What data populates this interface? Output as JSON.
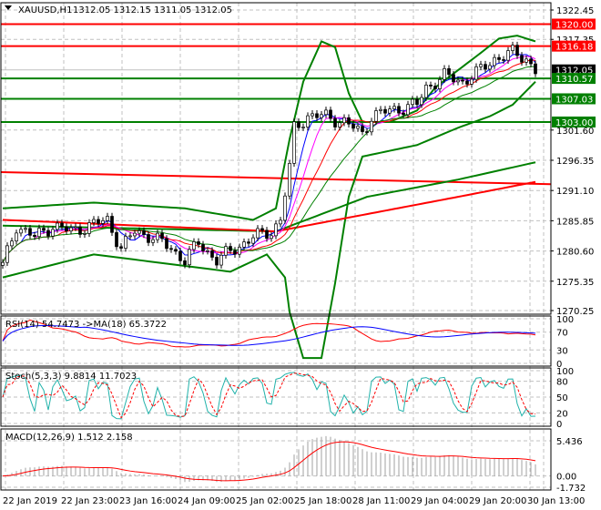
{
  "header": {
    "symbol": "XAUUSD,H1",
    "ohlc": "1312.05 1312.15 1311.05 1312.05"
  },
  "colors": {
    "up": "#008000",
    "down": "#000000",
    "bands": "#008000",
    "red": "#ff0000",
    "green_label": "#008000",
    "red_label": "#ff0000",
    "stoch_main": "#20b2aa",
    "rsi_ma": "#0000ff"
  },
  "chart_data": [
    {
      "type": "candlestick",
      "title": "XAUUSD,H1",
      "ylim": [
        1270.25,
        1322.45
      ],
      "yticks": [
        "1322.45",
        "1317.35",
        "1301.60",
        "1296.35",
        "1291.10",
        "1285.85",
        "1280.60",
        "1275.35",
        "1270.25"
      ],
      "xticks": [
        "22 Jan 2019",
        "22 Jan 23:00",
        "23 Jan 16:00",
        "24 Jan 09:00",
        "25 Jan 02:00",
        "25 Jan 18:00",
        "28 Jan 11:00",
        "29 Jan 04:00",
        "29 Jan 20:00",
        "30 Jan 13:00"
      ],
      "price_anchors": [
        [
          0,
          1278
        ],
        [
          3,
          1285
        ],
        [
          7,
          1283
        ],
        [
          11,
          1285
        ],
        [
          15,
          1284
        ],
        [
          19,
          1285
        ],
        [
          23,
          1286
        ],
        [
          26,
          1281
        ],
        [
          29,
          1284
        ],
        [
          33,
          1283
        ],
        [
          37,
          1281
        ],
        [
          40,
          1279
        ],
        [
          43,
          1282
        ],
        [
          47,
          1279
        ],
        [
          51,
          1281
        ],
        [
          55,
          1283
        ],
        [
          59,
          1284
        ],
        [
          61,
          1286
        ],
        [
          63,
          1295
        ],
        [
          64,
          1302
        ],
        [
          67,
          1304
        ],
        [
          71,
          1304
        ],
        [
          75,
          1303
        ],
        [
          79,
          1301
        ],
        [
          81,
          1304
        ],
        [
          85,
          1305
        ],
        [
          91,
          1306
        ],
        [
          93,
          1309
        ],
        [
          97,
          1311
        ],
        [
          101,
          1310
        ],
        [
          105,
          1312
        ],
        [
          108,
          1314
        ],
        [
          112,
          1315
        ],
        [
          115,
          1314
        ],
        [
          117,
          1312.05
        ]
      ],
      "bb_upper": [
        [
          0,
          1288
        ],
        [
          20,
          1289
        ],
        [
          40,
          1288
        ],
        [
          55,
          1286
        ],
        [
          60,
          1288
        ],
        [
          63,
          1300
        ],
        [
          66,
          1310
        ],
        [
          70,
          1317
        ],
        [
          73,
          1316
        ],
        [
          76,
          1308
        ],
        [
          79,
          1303
        ],
        [
          85,
          1303
        ],
        [
          91,
          1305
        ],
        [
          95,
          1309
        ],
        [
          100,
          1312
        ],
        [
          105,
          1315
        ],
        [
          109,
          1317.5
        ],
        [
          113,
          1318
        ],
        [
          117,
          1317
        ]
      ],
      "bb_lower": [
        [
          0,
          1276
        ],
        [
          5,
          1277
        ],
        [
          20,
          1280
        ],
        [
          40,
          1278
        ],
        [
          50,
          1277
        ],
        [
          58,
          1280
        ],
        [
          62,
          1276
        ],
        [
          63,
          1270
        ],
        [
          66,
          1262
        ],
        [
          70,
          1262
        ],
        [
          73,
          1275
        ],
        [
          76,
          1290
        ],
        [
          79,
          1297
        ],
        [
          85,
          1298
        ],
        [
          91,
          1299
        ],
        [
          100,
          1302
        ],
        [
          107,
          1304
        ],
        [
          112,
          1306
        ],
        [
          117,
          1310
        ]
      ],
      "ma_long_green": [
        [
          0,
          1285
        ],
        [
          60,
          1284
        ],
        [
          80,
          1290
        ],
        [
          100,
          1293
        ],
        [
          117,
          1296
        ]
      ],
      "ma_long_red": [
        [
          0,
          1286
        ],
        [
          60,
          1284
        ],
        [
          80,
          1287
        ],
        [
          100,
          1290
        ],
        [
          117,
          1292.6
        ]
      ],
      "trendline_red": [
        [
          0,
          1294.3
        ],
        [
          121,
          1292.2
        ]
      ],
      "levels": [
        {
          "price": 1320.0,
          "label": "1320.00",
          "color": "#ff0000"
        },
        {
          "price": 1316.18,
          "label": "1316.18",
          "color": "#ff0000"
        },
        {
          "price": 1312.05,
          "label": "1312.05",
          "color": "#000000",
          "line": "#c0c0c0"
        },
        {
          "price": 1310.57,
          "label": "1310.57",
          "color": "#008000"
        },
        {
          "price": 1307.03,
          "label": "1307.03",
          "color": "#008000"
        },
        {
          "price": 1303.0,
          "label": "1303.00",
          "color": "#008000"
        }
      ]
    },
    {
      "type": "line",
      "title": "RSI(14) 54.7473  ->MA(18) 65.3722",
      "ylim": [
        0,
        100
      ],
      "yticks": [
        "100",
        "70",
        "30",
        "0"
      ]
    },
    {
      "type": "line",
      "title": "Stoch(5,3,3) 9.8814 11.7023",
      "ylim": [
        0,
        100
      ],
      "yticks": [
        "100",
        "80",
        "50",
        "20",
        "0"
      ]
    },
    {
      "type": "bar",
      "title": "MACD(12,26,9) 1.512 2.158",
      "yticks": [
        "5.436",
        "0.00",
        "-1.732"
      ],
      "ylim": [
        -1.732,
        5.436
      ]
    }
  ]
}
